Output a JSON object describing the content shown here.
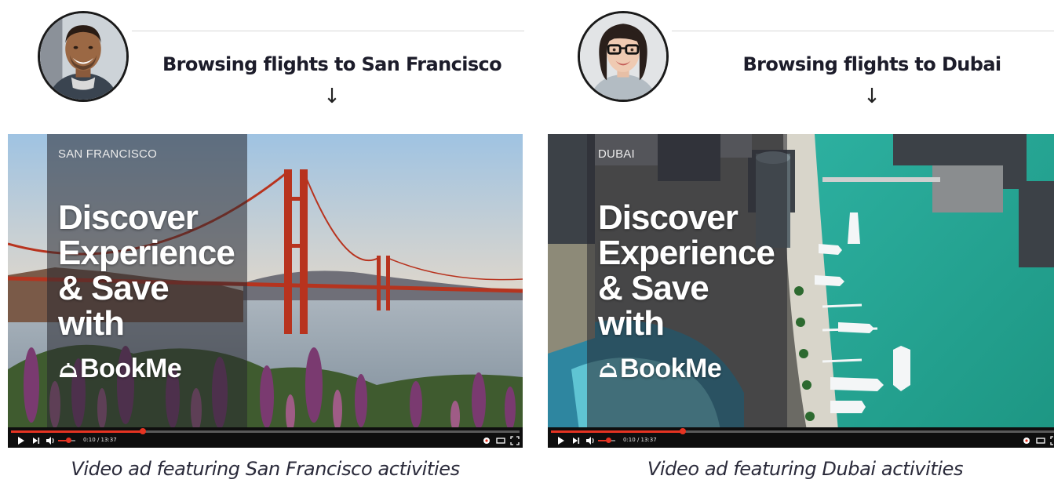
{
  "panels": [
    {
      "browse_text": "Browsing flights to San Francisco",
      "arrow": "↓",
      "city": "SAN FRANCISCO",
      "headline": [
        "Discover",
        "Experience",
        "& Save",
        "with"
      ],
      "brand": "BookMe",
      "time": "0:10 / 13:37",
      "progress": 0.26,
      "volume": 0.6,
      "caption": "Video ad featuring San Francisco activities"
    },
    {
      "browse_text": "Browsing flights to Dubai",
      "arrow": "↓",
      "city": "DUBAI",
      "headline": [
        "Discover",
        "Experience",
        "& Save",
        "with"
      ],
      "brand": "BookMe",
      "time": "0:10 / 13:37",
      "progress": 0.26,
      "volume": 0.6,
      "caption": "Video ad featuring Dubai activities"
    }
  ],
  "icons": [
    "person-man-avatar",
    "person-woman-avatar",
    "arrow-down-icon",
    "bell-icon",
    "play-icon",
    "next-icon",
    "volume-icon",
    "settings-icon",
    "theater-icon",
    "fullscreen-icon"
  ],
  "colors": {
    "progress": "#e53322",
    "text_dark": "#1c1c2a",
    "overlay": "#282830"
  }
}
